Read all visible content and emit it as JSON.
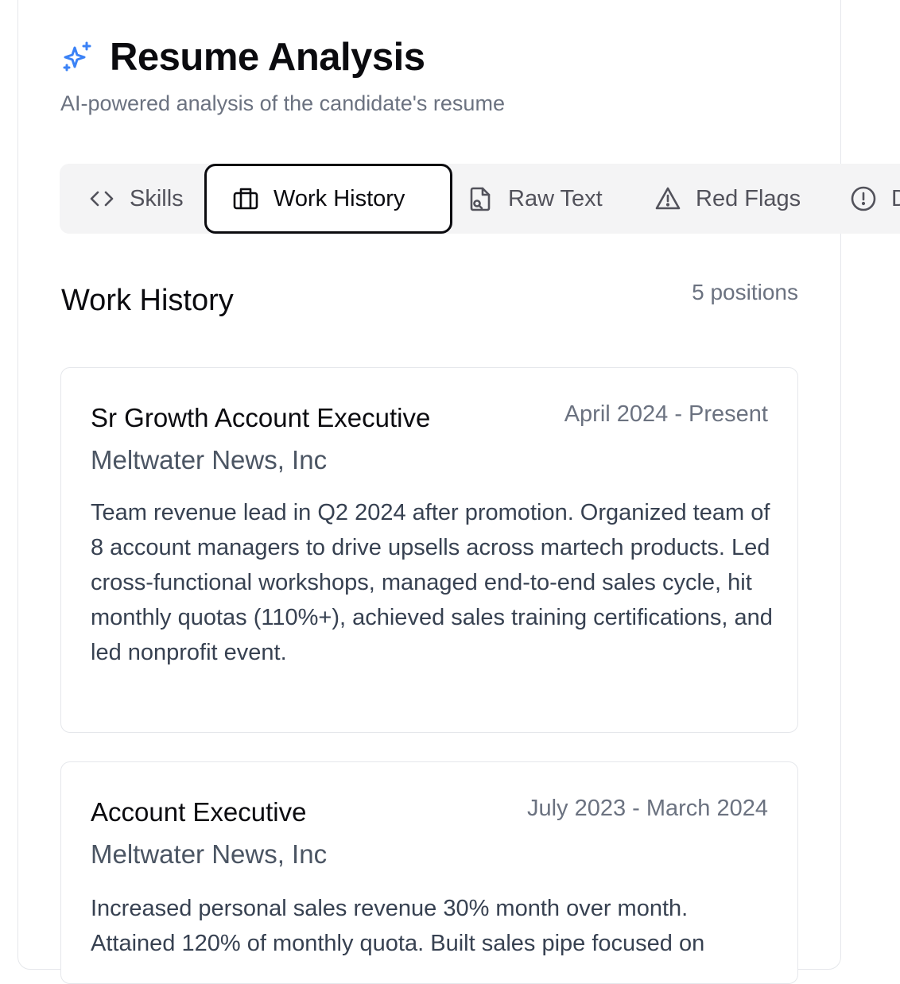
{
  "header": {
    "icon": "sparkles-icon",
    "title": "Resume Analysis",
    "subtitle": "AI-powered analysis of the candidate's resume"
  },
  "tabs": [
    {
      "label": "Skills",
      "icon": "code-icon",
      "active": false
    },
    {
      "label": "Work History",
      "icon": "briefcase-icon",
      "active": true
    },
    {
      "label": "Raw Text",
      "icon": "file-search-icon",
      "active": false
    },
    {
      "label": "Red Flags",
      "icon": "warning-triangle-icon",
      "active": false
    },
    {
      "label": "D",
      "icon": "alert-circle-icon",
      "active": false
    }
  ],
  "section": {
    "title": "Work History",
    "count": "5 positions"
  },
  "jobs": [
    {
      "title": "Sr Growth Account Executive",
      "dates": "April 2024 - Present",
      "company": "Meltwater News, Inc",
      "description": "Team revenue lead in Q2 2024 after promotion. Organized team of 8 account managers to drive upsells across martech products. Led cross-functional workshops, managed end-to-end sales cycle, hit monthly quotas (110%+), achieved sales training certifications, and led nonprofit event."
    },
    {
      "title": "Account Executive",
      "dates": "July 2023 - March 2024",
      "company": "Meltwater News, Inc",
      "description": "Increased personal sales revenue 30% month over month. Attained 120% of monthly quota. Built sales pipe focused on"
    }
  ],
  "colors": {
    "accent": "#3b82f6",
    "active_border": "#0b0b0f",
    "muted_text": "#6b7280"
  }
}
